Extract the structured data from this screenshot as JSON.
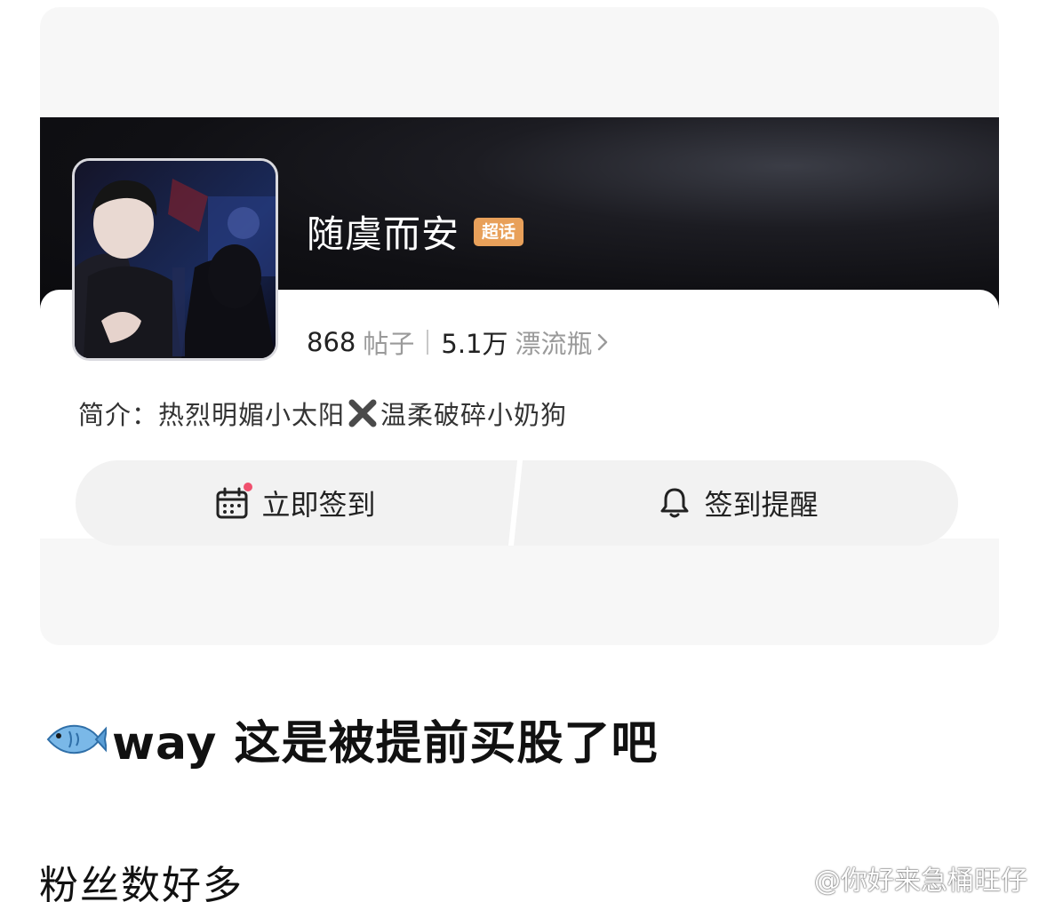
{
  "topic": {
    "name": "随虞而安",
    "badge": "超话",
    "posts_count": "868",
    "posts_label": "帖子",
    "bottles_count": "5.1万",
    "bottles_label": "漂流瓶",
    "intro_prefix": "简介：热烈明媚小太阳",
    "intro_suffix": "温柔破碎小奶狗"
  },
  "actions": {
    "checkin_label": "立即签到",
    "remind_label": "签到提醒"
  },
  "post": {
    "caption": "way 这是被提前买股了吧",
    "sub_caption": "粉丝数好多"
  },
  "watermark": {
    "text": "@你好来急桶旺仔"
  },
  "icons": {
    "calendar": "calendar-icon",
    "bell": "bell-icon",
    "chevron": "chevron-right-icon",
    "cross": "cross-mark-icon",
    "fish": "fish-icon",
    "weibo": "weibo-logo-icon"
  },
  "colors": {
    "badge": "#e8a05a",
    "notification_dot": "#f0506e",
    "banner": "#0a0a0d"
  }
}
